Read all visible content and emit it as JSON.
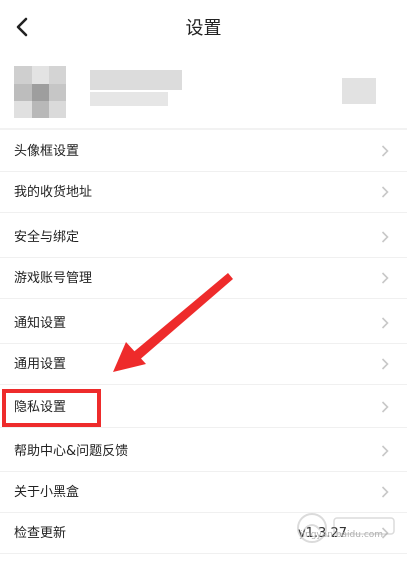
{
  "header": {
    "title": "设置",
    "back_icon": "chevron-left-icon"
  },
  "menu": {
    "items": [
      {
        "label": "头像框设置"
      },
      {
        "label": "我的收货地址"
      },
      {
        "label": "安全与绑定"
      },
      {
        "label": "游戏账号管理"
      },
      {
        "label": "通知设置"
      },
      {
        "label": "通用设置"
      },
      {
        "label": "隐私设置"
      },
      {
        "label": "帮助中心&问题反馈"
      },
      {
        "label": "关于小黑盒"
      },
      {
        "label": "检查更新",
        "value": "v1.3.27"
      }
    ]
  },
  "colors": {
    "annotation": "#ee2b2b",
    "chevron": "#c8c8c8",
    "divider": "#f0f0f0"
  },
  "watermark": {
    "logo": "baidu-jingyan-watermark",
    "text": "jingyan.baidu.com"
  }
}
